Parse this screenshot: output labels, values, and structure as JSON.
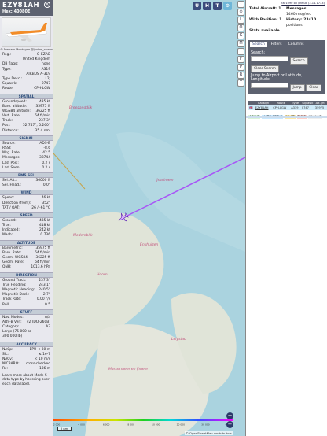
{
  "info": {
    "callsign": "EZY81AH",
    "hex_label": "Hex:",
    "hex": "40080E",
    "photo_credit": "© Marcelo Montagna\n@juntos_nuevo",
    "basics": [
      {
        "k": "Reg.:",
        "v": "G-EZAO"
      },
      {
        "k": "",
        "v": "United Kingdom"
      },
      {
        "k": "DB flags:",
        "v": "none"
      },
      {
        "k": "Type:",
        "v": "A319"
      },
      {
        "k": "",
        "v": "AIRBUS A-319"
      },
      {
        "k": "Type Desc.:",
        "v": "L2J"
      },
      {
        "k": "Squawk:",
        "v": "0747"
      },
      {
        "k": "Route:",
        "v": "CPH-LGW"
      }
    ],
    "sections": [
      {
        "title": "SPATIAL",
        "rows": [
          {
            "k": "Groundspeed:",
            "v": "435 kt"
          },
          {
            "k": "Baro. altitude:",
            "v": "35975 ft"
          },
          {
            "k": "WGS84 altitude:",
            "v": "36225 ft"
          },
          {
            "k": "Vert. Rate:",
            "v": "64 ft/min"
          },
          {
            "k": "Track:",
            "v": "237.3°"
          },
          {
            "k": "Pos.:",
            "v": "52.747°, 5.260°"
          },
          {
            "k": "Distance:",
            "v": "35.4 nmi"
          }
        ]
      },
      {
        "title": "SIGNAL",
        "rows": [
          {
            "k": "Source:",
            "v": "ADS-B"
          },
          {
            "k": "RSSI:",
            "v": "-8.6"
          },
          {
            "k": "Msg. Rate:",
            "v": "42.5"
          },
          {
            "k": "Messages:",
            "v": "38744"
          },
          {
            "k": "Last Pos.:",
            "v": "0.2 s"
          },
          {
            "k": "Last Seen:",
            "v": "0.2 s"
          }
        ]
      },
      {
        "title": "FMS SEL",
        "rows": [
          {
            "k": "Sel. Alt.:",
            "v": "36000 ft"
          },
          {
            "k": "Sel. Head.:",
            "v": "0.0°"
          }
        ]
      },
      {
        "title": "WIND",
        "rows": [
          {
            "k": "Speed:",
            "v": "46 kt"
          },
          {
            "k": "Direction (from):",
            "v": "352°"
          },
          {
            "k": "TAT / OAT:",
            "v": "-26 / -61 °C"
          }
        ]
      },
      {
        "title": "SPEED",
        "rows": [
          {
            "k": "Ground:",
            "v": "435 kt"
          },
          {
            "k": "True:",
            "v": "418 kt"
          },
          {
            "k": "Indicated:",
            "v": "242 kt"
          },
          {
            "k": "Mach:",
            "v": "0.736"
          }
        ]
      },
      {
        "title": "ALTITUDE",
        "rows": [
          {
            "k": "Barometric:",
            "v": "35975 ft"
          },
          {
            "k": "Baro. Rate:",
            "v": "64 ft/min"
          },
          {
            "k": "Geom. WGS84:",
            "v": "36225 ft"
          },
          {
            "k": "Geom. Rate:",
            "v": "64 ft/min"
          },
          {
            "k": "QNH:",
            "v": "1013.6 hPa"
          }
        ]
      },
      {
        "title": "DIRECTION",
        "rows": [
          {
            "k": "Ground Track:",
            "v": "237.3°"
          },
          {
            "k": "True Heading:",
            "v": "243.1°"
          },
          {
            "k": "Magnetic Heading:",
            "v": "240.5°"
          },
          {
            "k": "Magnetic Decl.:",
            "v": "2.7°"
          },
          {
            "k": "Track Rate:",
            "v": "0.00 °/s"
          },
          {
            "k": "Roll:",
            "v": "0.5"
          }
        ]
      },
      {
        "title": "STUFF",
        "rows": [
          {
            "k": "Nav. Modes:",
            "v": "n/a"
          },
          {
            "k": "ADS-B Ver.:",
            "v": "v2 (DO-260B)"
          },
          {
            "k": "Category:",
            "v": "A3"
          },
          {
            "k": "Large (75 000 to",
            "v": ""
          },
          {
            "k": "300 000 lb)",
            "v": ""
          }
        ]
      },
      {
        "title": "ACCURACY",
        "rows": [
          {
            "k": "NACp:",
            "v": "EPU < 30 m"
          },
          {
            "k": "SIL:",
            "v": "≤ 1e-7"
          },
          {
            "k": "NACv:",
            "v": "< 10 m/s"
          },
          {
            "k": "NICBARO:",
            "v": "cross-checked"
          },
          {
            "k": "Rc:",
            "v": "186 m"
          }
        ]
      }
    ],
    "footer": "Learn more about Mode S data type by hovering over each data label."
  },
  "top_buttons": [
    "U",
    "H",
    "T"
  ],
  "vbar": [
    "‹",
    "⊙",
    "L",
    "O",
    "K",
    "M",
    "I",
    "F",
    "P",
    "R",
    "T"
  ],
  "side": {
    "link": "tar1090 on github (3.14.1733)",
    "total_label": "Total Aircraft: 1",
    "messages_label": "Messages:",
    "messages_val": "1460 msg/sec",
    "pos_label": "With Position: 1",
    "history_label": "History: 23410",
    "history_val": "positions",
    "stats_label": "Stats available",
    "tabs": [
      "Search",
      "Filters",
      "Columns"
    ],
    "search_label": "Search:",
    "search_btn": "Search",
    "clear_btn": "Clear Search",
    "jump_label": "Jump to Airport or Latitude, Longitude:",
    "jump_btn": "Jump",
    "clear2_btn": "Clear",
    "table_headers": [
      "",
      "Callsign",
      "Route",
      "Type",
      "Squawk",
      "Alt. (ft)"
    ],
    "row": {
      "flag": "🇬🇧",
      "callsign": "EZY81AH",
      "route": "CPH-LGW",
      "type": "A319",
      "squawk": "0747",
      "alt": "35975"
    },
    "sources": [
      "ADS-B",
      "UAT / ADS-R",
      "MLAT",
      "TIS-B",
      "Mode-S"
    ],
    "source_colors": [
      "#d8f4d8",
      "#c8e8ff",
      "#ffe9a6",
      "#ffd0c8",
      "#eeeeee"
    ]
  },
  "map": {
    "labels": [
      "Breezanddijk",
      "IJsselmeer",
      "Medemblik",
      "Enkhuizen",
      "Hoorn",
      "Markermeer en IJmeer",
      "Lelystad"
    ],
    "scale": "5 nmi",
    "attribution": "© OpenStreetMap contributors.",
    "legend": [
      "2 000",
      "4 000",
      "6 000",
      "8 000",
      "10 000",
      "20 000",
      "30 000",
      "40 000+"
    ]
  },
  "colors": {
    "accent": "#3c4b7c",
    "track": "#a855f7",
    "water": "#aad3df",
    "land": "#e0e4d8"
  }
}
